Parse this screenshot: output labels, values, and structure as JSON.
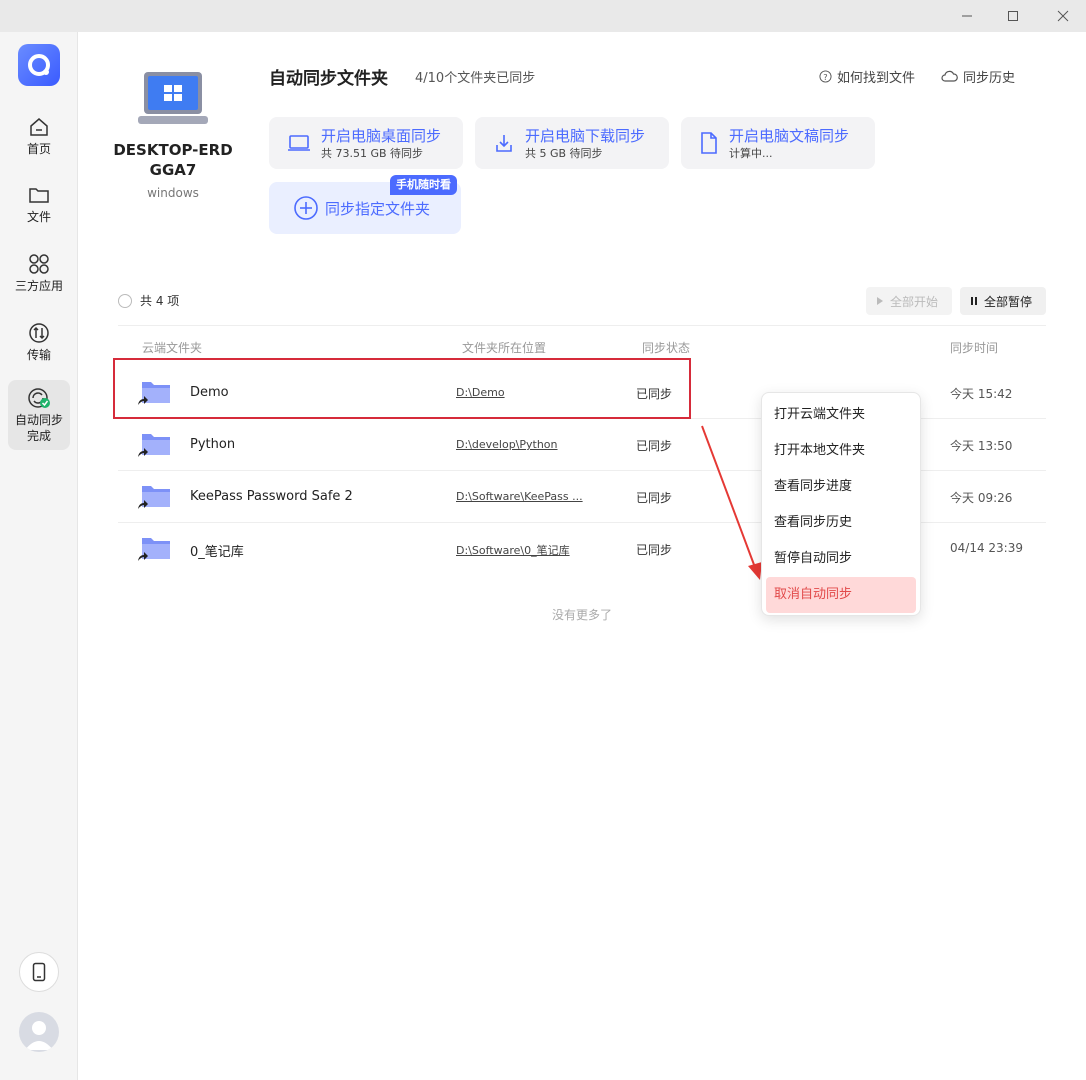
{
  "window": {
    "min_icon": "minimize-icon",
    "max_icon": "maximize-icon",
    "close_icon": "close-icon"
  },
  "sidebar": {
    "items": [
      {
        "label": "首页",
        "icon": "home-icon"
      },
      {
        "label": "文件",
        "icon": "folder-icon"
      },
      {
        "label": "三方应用",
        "icon": "apps-icon"
      },
      {
        "label": "传输",
        "icon": "transfer-icon"
      },
      {
        "label": "自动同步完成",
        "label_line1": "自动同步",
        "label_line2": "完成",
        "icon": "sync-icon"
      }
    ],
    "bottom": [
      {
        "icon": "phone-icon"
      },
      {
        "icon": "avatar-icon"
      }
    ]
  },
  "device": {
    "name": "DESKTOP-ERDGGA7",
    "os": "windows"
  },
  "header": {
    "title": "自动同步文件夹",
    "count": "4/10个文件夹已同步",
    "links": [
      {
        "label": "如何找到文件",
        "icon": "help-icon"
      },
      {
        "label": "同步历史",
        "icon": "cloud-icon"
      }
    ]
  },
  "cards": [
    {
      "title": "开启电脑桌面同步",
      "sub": "共 73.51 GB 待同步",
      "icon": "laptop-icon"
    },
    {
      "title": "开启电脑下载同步",
      "sub": "共 5 GB 待同步",
      "icon": "download-icon"
    },
    {
      "title": "开启电脑文稿同步",
      "sub": "计算中...",
      "icon": "document-icon"
    }
  ],
  "add_card": {
    "title": "同步指定文件夹",
    "badge": "手机随时看",
    "icon": "plus-circle-icon"
  },
  "list": {
    "total": "共 4 项",
    "start_all": "全部开始",
    "pause_all": "全部暂停",
    "columns": [
      "云端文件夹",
      "文件夹所在位置",
      "同步状态",
      "同步时间"
    ],
    "rows": [
      {
        "name": "Demo",
        "path": "D:\\Demo",
        "status": "已同步",
        "time": "今天 15:42"
      },
      {
        "name": "Python",
        "path": "D:\\develop\\Python",
        "status": "已同步",
        "time": "今天 13:50"
      },
      {
        "name": "KeePass Password Safe 2",
        "path": "D:\\Software\\KeePass ...",
        "status": "已同步",
        "time": "今天 09:26"
      },
      {
        "name": "0_笔记库",
        "path": "D:\\Software\\0_笔记库",
        "status": "已同步",
        "time": "04/14 23:39"
      }
    ],
    "no_more": "没有更多了"
  },
  "context_menu": {
    "items": [
      "打开云端文件夹",
      "打开本地文件夹",
      "查看同步进度",
      "查看同步历史",
      "暂停自动同步",
      "取消自动同步"
    ]
  },
  "colors": {
    "accent": "#4c6bff",
    "highlight_border": "#d62b3a",
    "danger_bg": "#ffd9d9",
    "danger_text": "#e24a4a"
  }
}
